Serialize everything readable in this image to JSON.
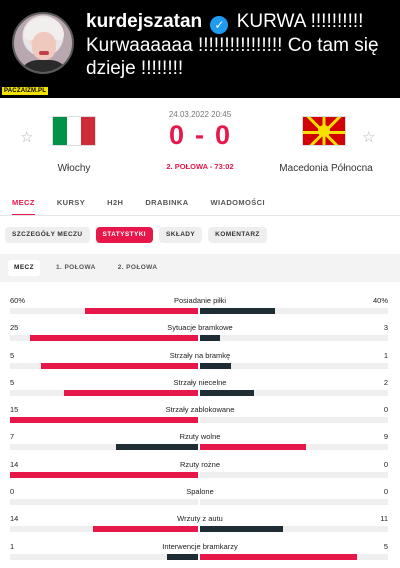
{
  "banner": {
    "username": "kurdejszatan",
    "tweet_text": "KURWA !!!!!!!!!! Kurwaaaaaa !!!!!!!!!!!!!!!! Co tam się dzieje !!!!!!!!",
    "watermark": "PACZAIZM.PL"
  },
  "match": {
    "datetime": "24.03.2022 20:45",
    "home_team": "Włochy",
    "away_team": "Macedonia Północna",
    "home_score": "0",
    "separator": "-",
    "away_score": "0",
    "status": "2. POŁOWA - 73:02"
  },
  "tabs": [
    "MECZ",
    "KURSY",
    "H2H",
    "DRABINKA",
    "WIADOMOŚCI"
  ],
  "pills": [
    "SZCZEGÓŁY MECZU",
    "STATYSTYKI",
    "SKŁADY",
    "KOMENTARZ"
  ],
  "subtabs": [
    "MECZ",
    "1. POŁOWA",
    "2. POŁOWA"
  ],
  "colors": {
    "accent": "#e8174a",
    "dark": "#1e2c33",
    "track": "#efefef"
  },
  "stats": [
    {
      "name": "Posiadanie piłki",
      "home": "60%",
      "away": "40%",
      "home_num": 60,
      "away_num": 40,
      "leader": "home"
    },
    {
      "name": "Sytuacje bramkowe",
      "home": "25",
      "away": "3",
      "home_num": 25,
      "away_num": 3,
      "leader": "home"
    },
    {
      "name": "Strzały na bramkę",
      "home": "5",
      "away": "1",
      "home_num": 5,
      "away_num": 1,
      "leader": "home"
    },
    {
      "name": "Strzały niecelne",
      "home": "5",
      "away": "2",
      "home_num": 5,
      "away_num": 2,
      "leader": "home"
    },
    {
      "name": "Strzały zablokowane",
      "home": "15",
      "away": "0",
      "home_num": 15,
      "away_num": 0,
      "leader": "home"
    },
    {
      "name": "Rzuty wolne",
      "home": "7",
      "away": "9",
      "home_num": 7,
      "away_num": 9,
      "leader": "away"
    },
    {
      "name": "Rzuty rożne",
      "home": "14",
      "away": "0",
      "home_num": 14,
      "away_num": 0,
      "leader": "home"
    },
    {
      "name": "Spalone",
      "home": "0",
      "away": "0",
      "home_num": 0,
      "away_num": 0,
      "leader": "none"
    },
    {
      "name": "Wrzuty z autu",
      "home": "14",
      "away": "11",
      "home_num": 14,
      "away_num": 11,
      "leader": "home"
    },
    {
      "name": "Interwencje bramkarzy",
      "home": "1",
      "away": "5",
      "home_num": 1,
      "away_num": 5,
      "leader": "away"
    }
  ]
}
